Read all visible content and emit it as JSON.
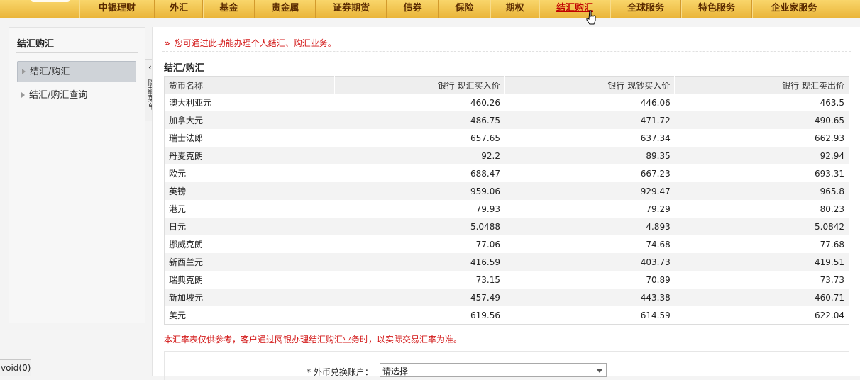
{
  "nav": {
    "items": [
      {
        "label": "中银理财"
      },
      {
        "label": "外汇"
      },
      {
        "label": "基金"
      },
      {
        "label": "贵金属"
      },
      {
        "label": "证券期货"
      },
      {
        "label": "债券"
      },
      {
        "label": "保险"
      },
      {
        "label": "期权"
      },
      {
        "label": "结汇购汇",
        "active": true
      },
      {
        "label": "全球服务"
      },
      {
        "label": "特色服务"
      },
      {
        "label": "企业家服务"
      }
    ]
  },
  "sidebar": {
    "title": "结汇购汇",
    "items": [
      {
        "label": "结汇/购汇",
        "selected": true
      },
      {
        "label": "结汇/购汇查询"
      }
    ],
    "hide_arrow": "‹",
    "hide_label": "隐藏菜单"
  },
  "main": {
    "notice_icon": "»",
    "notice": "您可通过此功能办理个人结汇、购汇业务。",
    "section_title": "结汇/购汇",
    "table": {
      "headers": [
        "货币名称",
        "银行 现汇买入价",
        "银行 现钞买入价",
        "银行 现汇卖出价"
      ],
      "rows": [
        [
          "澳大利亚元",
          "460.26",
          "446.06",
          "463.5"
        ],
        [
          "加拿大元",
          "486.75",
          "471.72",
          "490.65"
        ],
        [
          "瑞士法郎",
          "657.65",
          "637.34",
          "662.93"
        ],
        [
          "丹麦克朗",
          "92.2",
          "89.35",
          "92.94"
        ],
        [
          "欧元",
          "688.47",
          "667.23",
          "693.31"
        ],
        [
          "英镑",
          "959.06",
          "929.47",
          "965.8"
        ],
        [
          "港元",
          "79.93",
          "79.29",
          "80.23"
        ],
        [
          "日元",
          "5.0488",
          "4.893",
          "5.0842"
        ],
        [
          "挪威克朗",
          "77.06",
          "74.68",
          "77.68"
        ],
        [
          "新西兰元",
          "416.59",
          "403.73",
          "419.51"
        ],
        [
          "瑞典克朗",
          "73.15",
          "70.89",
          "73.73"
        ],
        [
          "新加坡元",
          "457.49",
          "443.38",
          "460.71"
        ],
        [
          "美元",
          "619.56",
          "614.59",
          "622.04"
        ]
      ]
    },
    "disclaimer": "本汇率表仅供参考，客户通过网银办理结汇购汇业务时，以实际交易汇率为准。",
    "form": {
      "account_label": "*  外币兑换账户：",
      "account_value": "请选择"
    }
  },
  "statusbar": {
    "text": "void(0);"
  },
  "colors": {
    "nav_bg": "#f0c04e",
    "accent_red": "#d31919",
    "active_nav": "#c00000"
  }
}
